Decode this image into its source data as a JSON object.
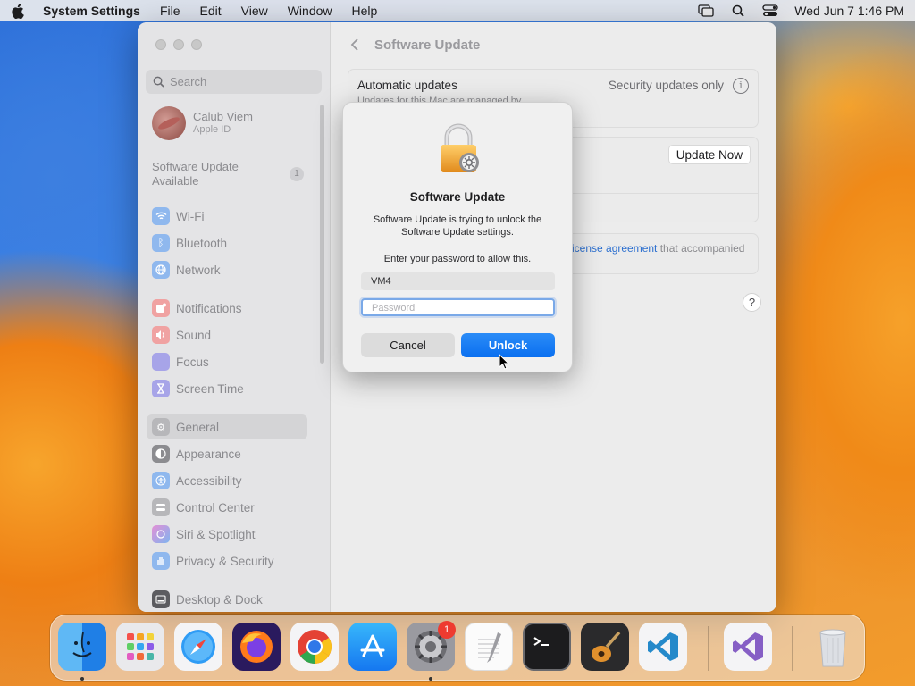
{
  "menubar": {
    "app_name": "System Settings",
    "menus": [
      "File",
      "Edit",
      "View",
      "Window",
      "Help"
    ],
    "clock": "Wed Jun 7  1:46 PM"
  },
  "sidebar": {
    "search_placeholder": "Search",
    "profile": {
      "name": "Calub Viem",
      "subtitle": "Apple ID"
    },
    "update_label_1": "Software Update",
    "update_label_2": "Available",
    "update_badge": "1",
    "items": [
      {
        "label": "Wi-Fi",
        "icon": "wifi-icon"
      },
      {
        "label": "Bluetooth",
        "icon": "bluetooth-icon"
      },
      {
        "label": "Network",
        "icon": "network-icon"
      },
      {
        "label": "Notifications",
        "icon": "notifications-icon"
      },
      {
        "label": "Sound",
        "icon": "sound-icon"
      },
      {
        "label": "Focus",
        "icon": "focus-icon"
      },
      {
        "label": "Screen Time",
        "icon": "screen-time-icon"
      },
      {
        "label": "General",
        "icon": "general-icon",
        "selected": true
      },
      {
        "label": "Appearance",
        "icon": "appearance-icon"
      },
      {
        "label": "Accessibility",
        "icon": "accessibility-icon"
      },
      {
        "label": "Control Center",
        "icon": "control-center-icon"
      },
      {
        "label": "Siri & Spotlight",
        "icon": "siri-icon"
      },
      {
        "label": "Privacy & Security",
        "icon": "privacy-icon"
      },
      {
        "label": "Desktop & Dock",
        "icon": "desktop-dock-icon"
      }
    ]
  },
  "main": {
    "title": "Software Update",
    "auto_updates_label": "Automatic updates",
    "auto_updates_sub": "Updates for this Mac are managed by",
    "auto_updates_value": "Security updates only",
    "update_now_label": "Update Now",
    "license_link": "icense agreement",
    "license_rest": " that accompanied",
    "help_label": "?"
  },
  "dialog": {
    "title": "Software Update",
    "message": "Software Update is trying to unlock the Software Update settings.",
    "prompt": "Enter your password to allow this.",
    "username_value": "VM4",
    "password_placeholder": "Password",
    "cancel_label": "Cancel",
    "unlock_label": "Unlock"
  },
  "dock": {
    "apps": [
      "Finder",
      "Launchpad",
      "Safari",
      "Firefox",
      "Chrome",
      "App Store",
      "System Settings",
      "TextEdit",
      "Terminal",
      "GarageBand",
      "Visual Studio Code",
      "Visual Studio",
      "Trash"
    ],
    "settings_badge": "1"
  },
  "colors": {
    "accent": "#0a6ff0",
    "link": "#2c6fcf",
    "badge": "#ee3b30"
  }
}
